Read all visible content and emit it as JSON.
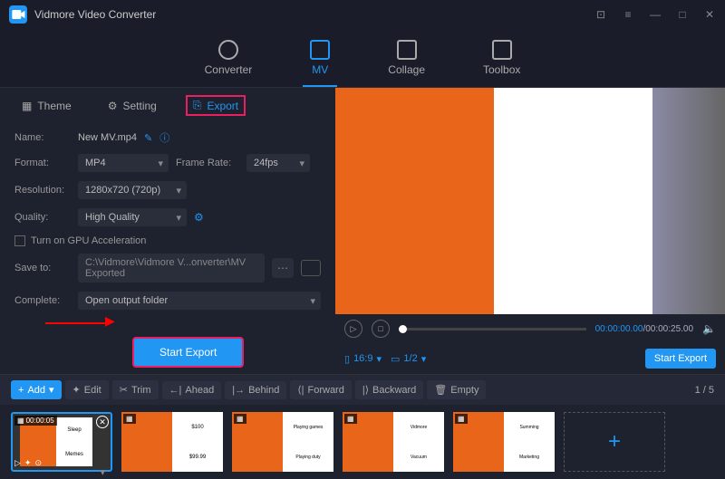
{
  "app": {
    "title": "Vidmore Video Converter"
  },
  "topnav": {
    "converter": "Converter",
    "mv": "MV",
    "collage": "Collage",
    "toolbox": "Toolbox"
  },
  "tabs": {
    "theme": "Theme",
    "setting": "Setting",
    "export": "Export"
  },
  "form": {
    "name_lbl": "Name:",
    "name_val": "New MV.mp4",
    "format_lbl": "Format:",
    "format_val": "MP4",
    "framerate_lbl": "Frame Rate:",
    "framerate_val": "24fps",
    "resolution_lbl": "Resolution:",
    "resolution_val": "1280x720 (720p)",
    "quality_lbl": "Quality:",
    "quality_val": "High Quality",
    "gpu": "Turn on GPU Acceleration",
    "saveto_lbl": "Save to:",
    "saveto_val": "C:\\Vidmore\\Vidmore V...onverter\\MV Exported",
    "complete_lbl": "Complete:",
    "complete_val": "Open output folder",
    "startexport": "Start Export"
  },
  "player": {
    "time_cur": "00:00:00.00",
    "time_total": "/00:00:25.00",
    "aspect": "16:9",
    "pages": "1/2",
    "startexport": "Start Export"
  },
  "toolbar": {
    "add": "Add",
    "edit": "Edit",
    "trim": "Trim",
    "ahead": "Ahead",
    "behind": "Behind",
    "forward": "Forward",
    "backward": "Backward",
    "empty": "Empty",
    "count": "1 / 5"
  },
  "thumbs": {
    "duration": "00:00:05"
  }
}
